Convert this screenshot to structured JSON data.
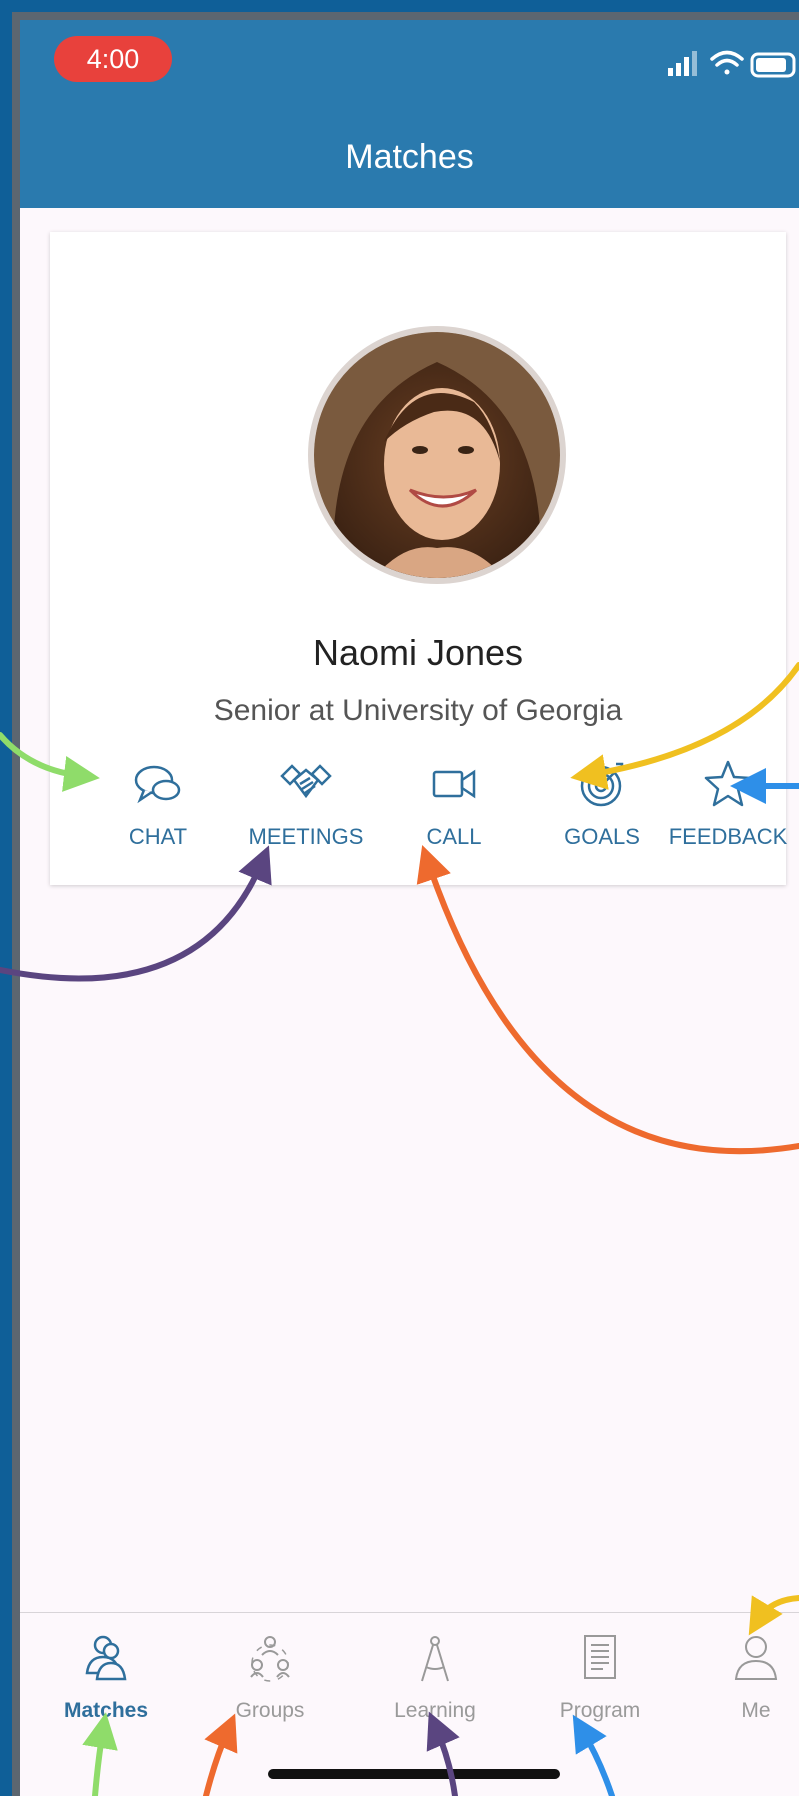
{
  "status_bar": {
    "time": "4:00"
  },
  "header": {
    "title": "Matches"
  },
  "match_card": {
    "name": "Naomi Jones",
    "subtitle": "Senior at University of Georgia",
    "actions": [
      {
        "label": "CHAT",
        "icon": "chat-icon"
      },
      {
        "label": "MEETINGS",
        "icon": "handshake-icon"
      },
      {
        "label": "CALL",
        "icon": "video-camera-icon"
      },
      {
        "label": "GOALS",
        "icon": "target-icon"
      },
      {
        "label": "FEEDBACK",
        "icon": "star-icon"
      }
    ]
  },
  "tab_bar": {
    "tabs": [
      {
        "label": "Matches",
        "icon": "people-icon",
        "active": true
      },
      {
        "label": "Groups",
        "icon": "group-icon",
        "active": false
      },
      {
        "label": "Learning",
        "icon": "compass-icon",
        "active": false
      },
      {
        "label": "Program",
        "icon": "document-icon",
        "active": false
      },
      {
        "label": "Me",
        "icon": "person-icon",
        "active": false
      }
    ]
  },
  "colors": {
    "header": "#2a7aae",
    "accent": "#2f6f9c",
    "time_pill": "#e8413c",
    "annotation_green": "#8fdc6a",
    "annotation_purple": "#5a4580",
    "annotation_orange": "#ee6a2e",
    "annotation_yellow": "#f0c020",
    "annotation_blue": "#2e8fe8"
  }
}
